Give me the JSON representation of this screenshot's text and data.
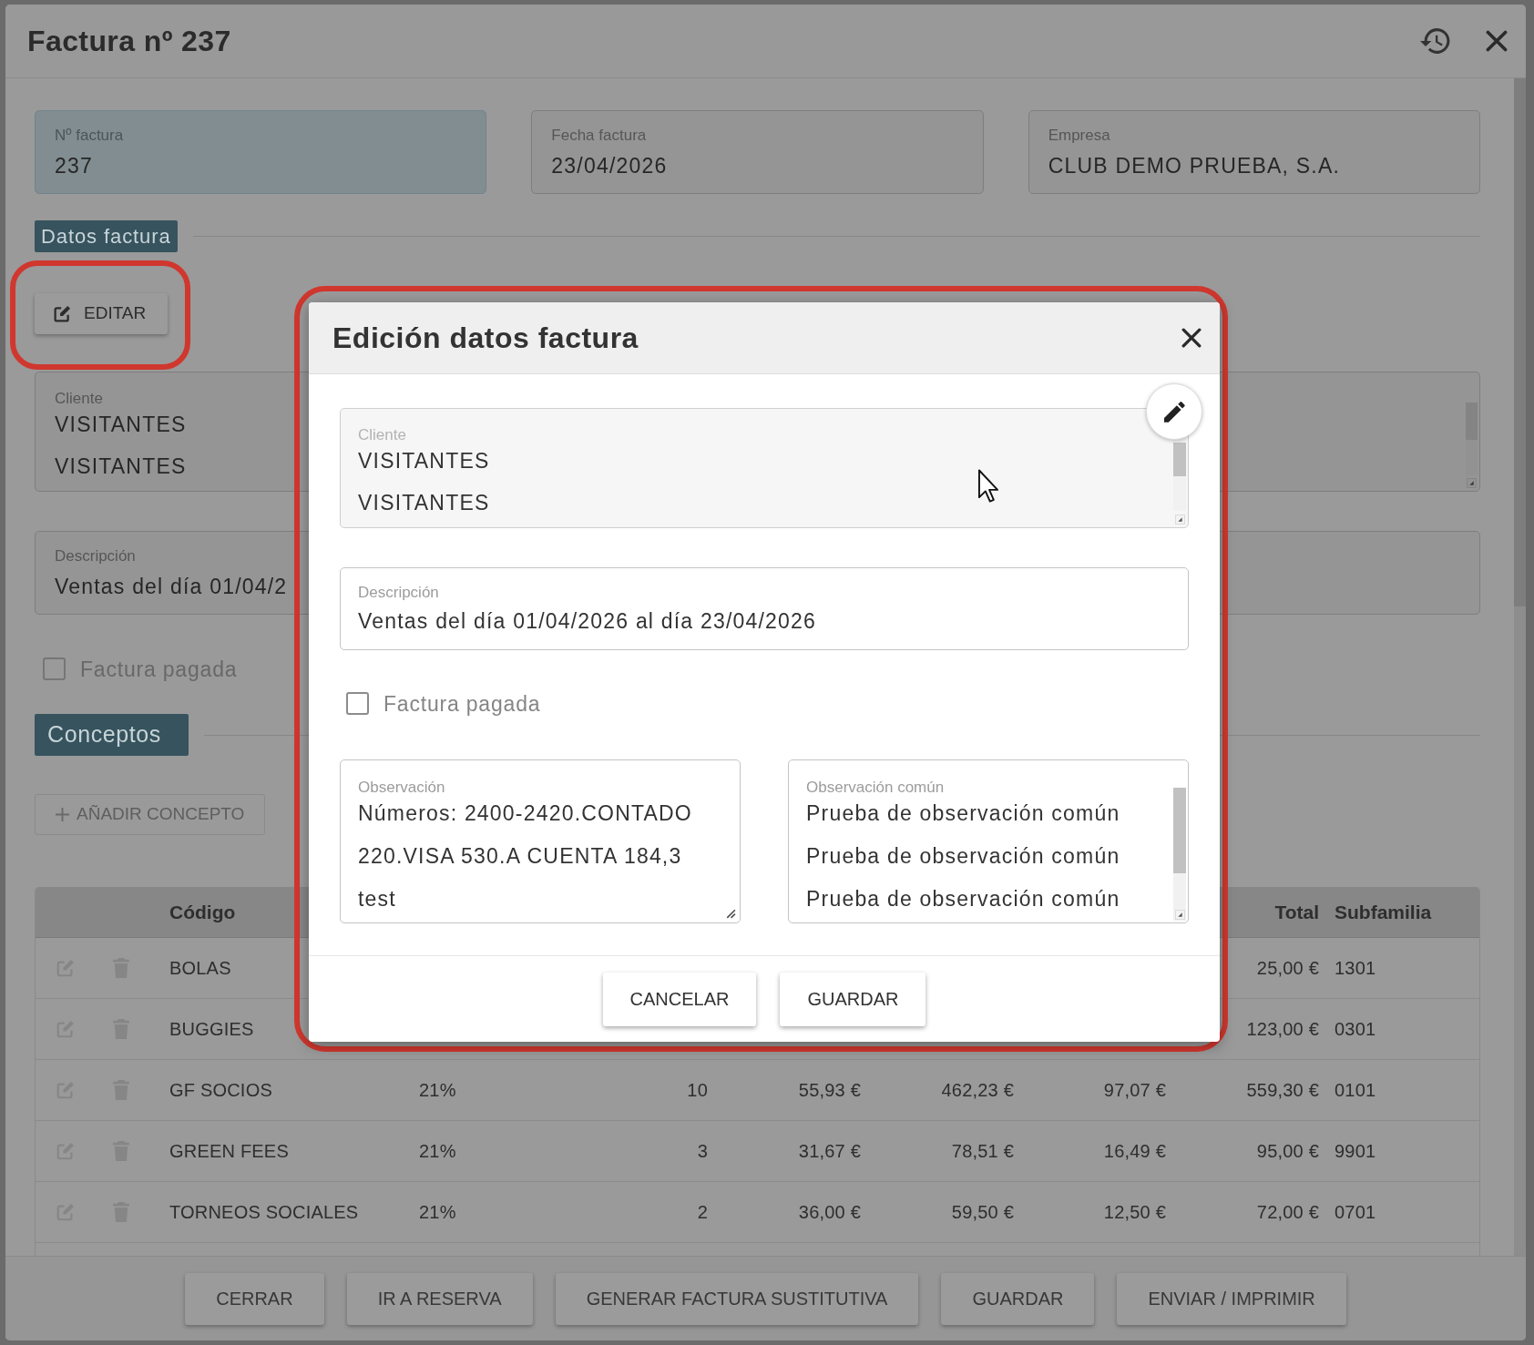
{
  "window": {
    "title": "Factura nº 237"
  },
  "header_fields": [
    {
      "label": "Nº factura",
      "value": "237",
      "readonly": true
    },
    {
      "label": "Fecha factura",
      "value": "23/04/2026",
      "readonly": false
    },
    {
      "label": "Empresa",
      "value": "CLUB DEMO PRUEBA, S.A.",
      "readonly": false
    }
  ],
  "invoice_section": {
    "title": "Datos factura",
    "edit_button": {
      "label": "EDITAR",
      "highlighted": true
    },
    "cliente": {
      "label": "Cliente",
      "lines": [
        "VISITANTES",
        "VISITANTES"
      ]
    },
    "descripcion": {
      "label": "Descripción",
      "value": "Ventas del día 01/04/2"
    },
    "paid_checkbox": {
      "label": "Factura pagada",
      "checked": false
    }
  },
  "concepts_section": {
    "title": "Conceptos",
    "add_button": {
      "label": "AÑADIR CONCEPTO",
      "disabled": true
    },
    "table": {
      "columns": {
        "codigo": "Código",
        "total": "Total",
        "subfamilia": "Subfamilia"
      },
      "rows": [
        {
          "codigo": "BOLAS",
          "total": "25,00 €",
          "subfamilia": "1301"
        },
        {
          "codigo": "BUGGIES",
          "total": "123,00 €",
          "subfamilia": "0301"
        },
        {
          "codigo": "GF SOCIOS",
          "column_4": "21%",
          "column_5": "10",
          "column_6": "55,93 €",
          "column_7": "462,23 €",
          "column_8": "97,07 €",
          "total": "559,30 €",
          "subfamilia": "0101"
        },
        {
          "codigo": "GREEN FEES",
          "column_4": "21%",
          "column_5": "3",
          "column_6": "31,67 €",
          "column_7": "78,51 €",
          "column_8": "16,49 €",
          "total": "95,00 €",
          "subfamilia": "9901"
        },
        {
          "codigo": "TORNEOS SOCIALES",
          "column_4": "21%",
          "column_5": "2",
          "column_6": "36,00 €",
          "column_7": "59,50 €",
          "column_8": "12,50 €",
          "total": "72,00 €",
          "subfamilia": "0701"
        }
      ]
    }
  },
  "footer_buttons": [
    "CERRAR",
    "IR A RESERVA",
    "GENERAR FACTURA SUSTITUTIVA",
    "GUARDAR",
    "ENVIAR / IMPRIMIR"
  ],
  "modal": {
    "title": "Edición datos factura",
    "highlighted": true,
    "cliente": {
      "label": "Cliente",
      "lines": [
        "VISITANTES",
        "VISITANTES"
      ]
    },
    "descripcion": {
      "label": "Descripción",
      "value": "Ventas del día 01/04/2026 al día 23/04/2026"
    },
    "paid_checkbox": {
      "label": "Factura pagada",
      "checked": false
    },
    "observacion": {
      "label": "Observación",
      "lines": [
        "Números: 2400-2420.CONTADO",
        "220.VISA 530.A CUENTA 184,3",
        "test"
      ]
    },
    "observacion_comun": {
      "label": "Observación común",
      "lines": [
        "Prueba de observación común",
        "Prueba de observación común",
        "Prueba de observación común"
      ]
    },
    "buttons": [
      "CANCELAR",
      "GUARDAR"
    ]
  }
}
